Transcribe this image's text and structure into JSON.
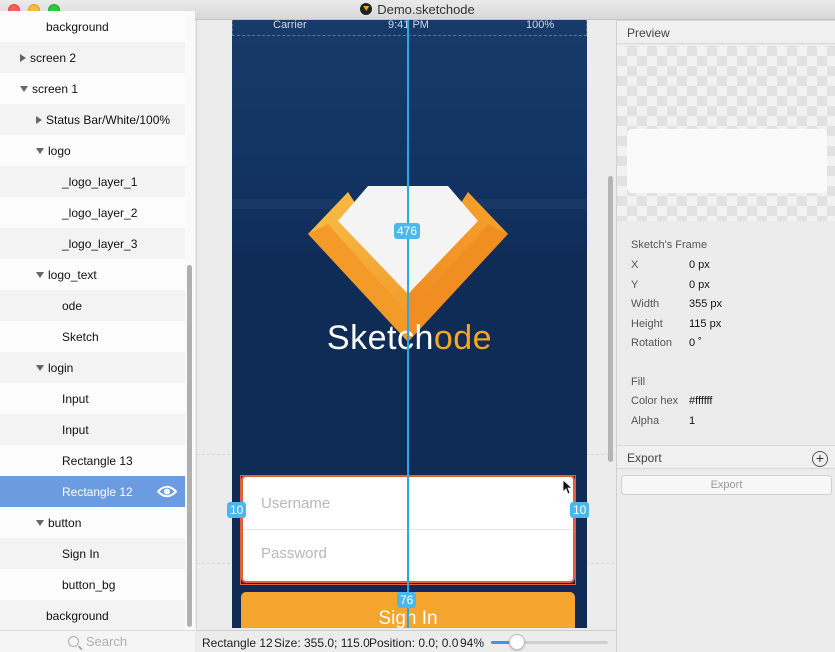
{
  "window": {
    "title": "Demo.sketchode"
  },
  "layers": [
    {
      "label": "background",
      "indent": 3,
      "arrow": "none"
    },
    {
      "label": "screen 2",
      "indent": 1,
      "arrow": "right"
    },
    {
      "label": "screen 1",
      "indent": 1,
      "arrow": "down"
    },
    {
      "label": "Status Bar/White/100%",
      "indent": 2,
      "arrow": "right"
    },
    {
      "label": "logo",
      "indent": 2,
      "arrow": "down"
    },
    {
      "label": "_logo_layer_1",
      "indent": 4,
      "arrow": "none"
    },
    {
      "label": "_logo_layer_2",
      "indent": 4,
      "arrow": "none"
    },
    {
      "label": "_logo_layer_3",
      "indent": 4,
      "arrow": "none"
    },
    {
      "label": "logo_text",
      "indent": 2,
      "arrow": "down"
    },
    {
      "label": "ode",
      "indent": 4,
      "arrow": "none"
    },
    {
      "label": "Sketch",
      "indent": 4,
      "arrow": "none"
    },
    {
      "label": "login",
      "indent": 2,
      "arrow": "down"
    },
    {
      "label": "Input",
      "indent": 4,
      "arrow": "none"
    },
    {
      "label": "Input",
      "indent": 4,
      "arrow": "none"
    },
    {
      "label": "Rectangle 13",
      "indent": 4,
      "arrow": "none"
    },
    {
      "label": "Rectangle 12",
      "indent": 4,
      "arrow": "none",
      "selected": true
    },
    {
      "label": "button",
      "indent": 2,
      "arrow": "down"
    },
    {
      "label": "Sign In",
      "indent": 4,
      "arrow": "none"
    },
    {
      "label": "button_bg",
      "indent": 4,
      "arrow": "none"
    },
    {
      "label": "background",
      "indent": 3,
      "arrow": "none"
    }
  ],
  "search": {
    "placeholder": "Search"
  },
  "artboard": {
    "status_carrier": "Carrier",
    "status_time": "9:41 PM",
    "status_battery": "100%",
    "logo_text_a": "Sketch",
    "logo_text_b": "ode",
    "username_placeholder": "Username",
    "password_placeholder": "Password",
    "signin_label": "Sign In"
  },
  "measurements": {
    "vertical_top": "476",
    "left_gap": "10",
    "right_gap": "10",
    "vertical_bottom": "76"
  },
  "statusbar": {
    "layer_name": "Rectangle 12",
    "size": "Size: 355.0; 115.0",
    "position": "Position: 0.0; 0.0",
    "zoom": "94%"
  },
  "zoom_level": 0.22,
  "inspector": {
    "preview_title": "Preview",
    "frame_title": "Sketch's Frame",
    "props": [
      {
        "label": "X",
        "value": "0 px"
      },
      {
        "label": "Y",
        "value": "0 px"
      },
      {
        "label": "Width",
        "value": "355 px"
      },
      {
        "label": "Height",
        "value": "115 px"
      },
      {
        "label": "Rotation",
        "value": "0 ˚"
      }
    ],
    "fill_title": "Fill",
    "fill_props": [
      {
        "label": "Color hex",
        "value": "#ffffff"
      },
      {
        "label": "Alpha",
        "value": "1"
      }
    ],
    "export_title": "Export",
    "export_button": "Export"
  },
  "colors": {
    "accent": "#f6a623",
    "selection": "#6b9be0",
    "measure": "#27a9e8",
    "artboard": "#0f2b55"
  }
}
